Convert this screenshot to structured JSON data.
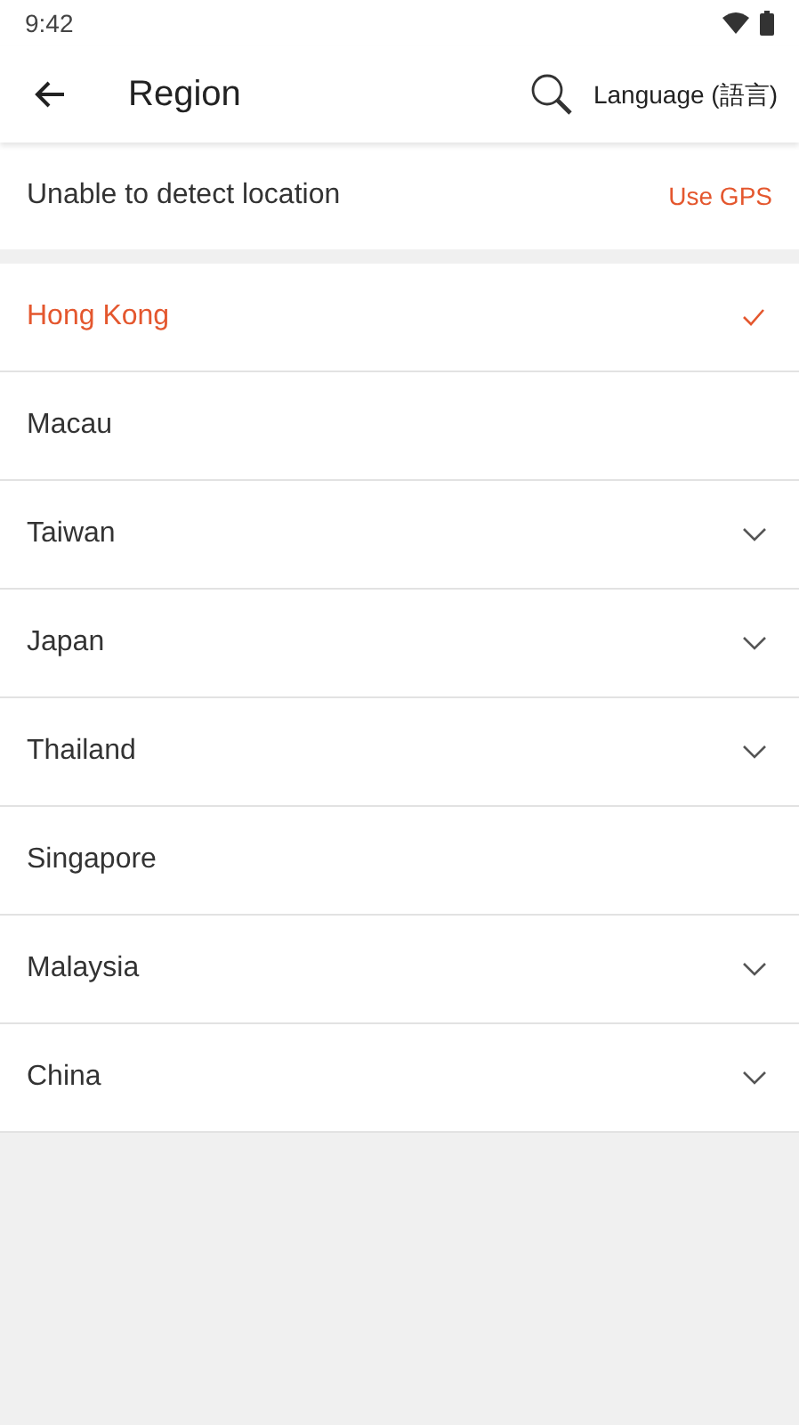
{
  "status_bar": {
    "time": "9:42"
  },
  "app_bar": {
    "title": "Region",
    "language": "Language (語言)"
  },
  "location": {
    "message": "Unable to detect location",
    "action": "Use GPS"
  },
  "regions": [
    {
      "name": "Hong Kong",
      "selected": true
    },
    {
      "name": "Macau",
      "selected": false,
      "expandable": false
    },
    {
      "name": "Taiwan",
      "selected": false,
      "expandable": true
    },
    {
      "name": "Japan",
      "selected": false,
      "expandable": true
    },
    {
      "name": "Thailand",
      "selected": false,
      "expandable": true
    },
    {
      "name": "Singapore",
      "selected": false,
      "expandable": false
    },
    {
      "name": "Malaysia",
      "selected": false,
      "expandable": true
    },
    {
      "name": "China",
      "selected": false,
      "expandable": true
    }
  ]
}
